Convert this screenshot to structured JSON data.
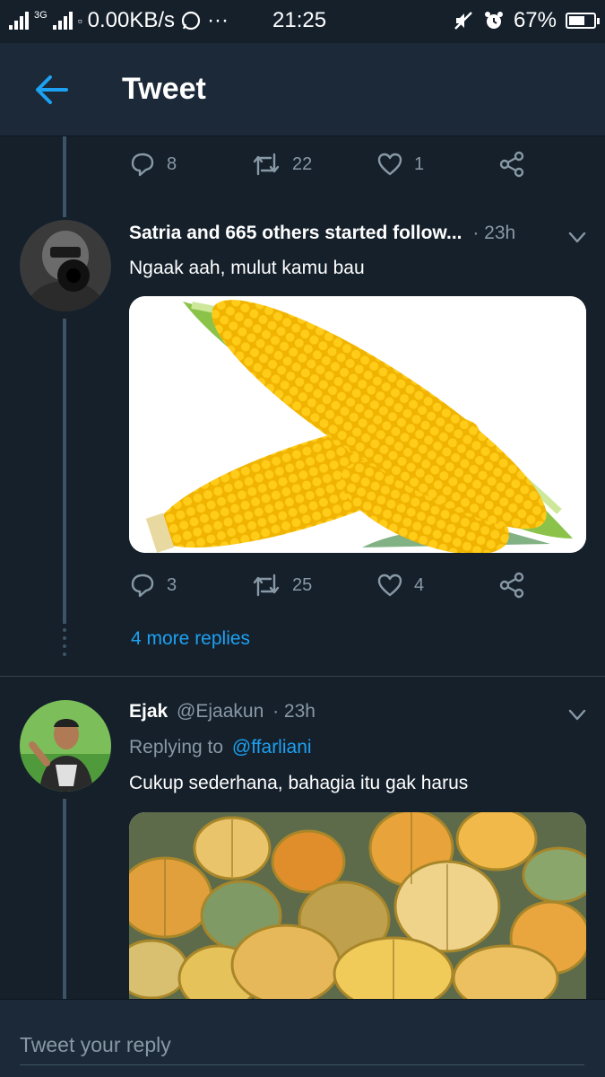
{
  "status_bar": {
    "network": "3G",
    "speed": "0.00KB/s",
    "more": "···",
    "time": "21:25",
    "battery": "67%",
    "battery_level": 0.67
  },
  "header": {
    "title": "Tweet",
    "accent": "#1da1f2"
  },
  "top_actions": {
    "replies": "8",
    "retweets": "22",
    "likes": "1"
  },
  "tweet1": {
    "name": "Satria and 665 others started follow...",
    "time": "· 23h",
    "text": "Ngaak aah, mulut kamu bau",
    "image": "corn-image",
    "actions": {
      "replies": "3",
      "retweets": "25",
      "likes": "4"
    }
  },
  "more_replies": "4 more replies",
  "tweet2": {
    "name": "Ejak",
    "handle": "@Ejaakun",
    "time": "· 23h",
    "replying_prefix": "Replying to",
    "replying_to": "@ffarliani",
    "text": "Cukup sederhana, bahagia itu gak harus",
    "image": "melons-image"
  },
  "reply_bar": {
    "placeholder": "Tweet your reply"
  }
}
